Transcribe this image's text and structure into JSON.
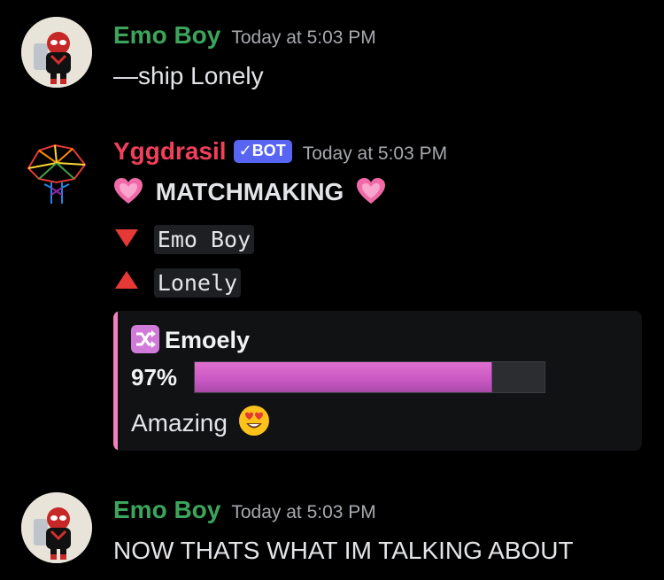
{
  "messages": [
    {
      "author": "Emo Boy",
      "author_color": "#3ba55c",
      "timestamp": "Today at 5:03 PM",
      "text": "—ship Lonely"
    },
    {
      "author": "Yggdrasil",
      "author_color": "#f23f5a",
      "badge": "BOT",
      "badge_check": "✓",
      "timestamp": "Today at 5:03 PM",
      "heading": "MATCHMAKING",
      "heading_emoji": "heart-pink-icon",
      "user1_emoji": "red-triangle-down-icon",
      "user1": "Emo Boy",
      "user2_emoji": "red-triangle-up-icon",
      "user2": "Lonely",
      "embed": {
        "accent_color": "#f47fbf",
        "title_icon": "shuffle-icon",
        "title": "Emoely",
        "percent_label": "97%",
        "percent_value": 0.85,
        "verdict": "Amazing",
        "verdict_emoji": "heart-eyes-icon"
      }
    },
    {
      "author": "Emo Boy",
      "author_color": "#3ba55c",
      "timestamp": "Today at 5:03 PM",
      "text": "NOW THATS WHAT IM TALKING ABOUT"
    }
  ]
}
